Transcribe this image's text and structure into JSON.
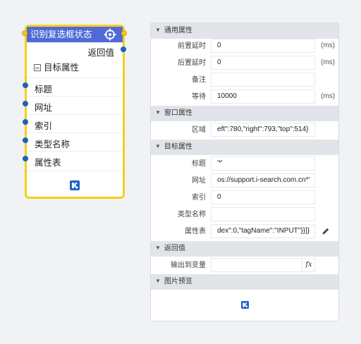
{
  "node": {
    "title": "识别复选框状态",
    "return_label": "返回值",
    "group_label": "目标属性",
    "rows": [
      {
        "label": "标题"
      },
      {
        "label": "网址"
      },
      {
        "label": "索引"
      },
      {
        "label": "类型名称"
      },
      {
        "label": "属性表"
      }
    ]
  },
  "panel": {
    "sections": {
      "general": "通用属性",
      "window": "窗口属性",
      "target": "目标属性",
      "return": "返回值",
      "preview": "图片预览"
    },
    "general": {
      "pre_delay_label": "前置延时",
      "pre_delay_value": "0",
      "pre_delay_unit": "(ms)",
      "post_delay_label": "后置延时",
      "post_delay_value": "0",
      "post_delay_unit": "(ms)",
      "note_label": "备注",
      "note_value": "",
      "wait_label": "等待",
      "wait_value": "10000",
      "wait_unit": "(ms)"
    },
    "window": {
      "region_label": "区域",
      "region_value": "eft\":780,\"right\":793,\"top\":514}"
    },
    "target": {
      "title_label": "标题",
      "title_value": "'*'",
      "url_label": "网址",
      "url_value": "os://support.i-search.com.cn*'",
      "index_label": "索引",
      "index_value": "0",
      "type_label": "类型名称",
      "type_value": "",
      "attr_label": "属性表",
      "attr_value": "dex\":0,\"tagName\":\"INPUT\"}}]}"
    },
    "return": {
      "output_label": "输出到变量",
      "output_value": "",
      "fx_label": "fx"
    }
  },
  "colors": {
    "header": "#4f6ad6",
    "border": "#f6cf1a",
    "port_blue": "#1f5fbf",
    "port_yellow": "#f5c518"
  },
  "icons": [
    "target-icon",
    "minus-box-icon",
    "pencil-icon",
    "fx-icon",
    "app-logo-icon",
    "chevron-down-icon"
  ]
}
